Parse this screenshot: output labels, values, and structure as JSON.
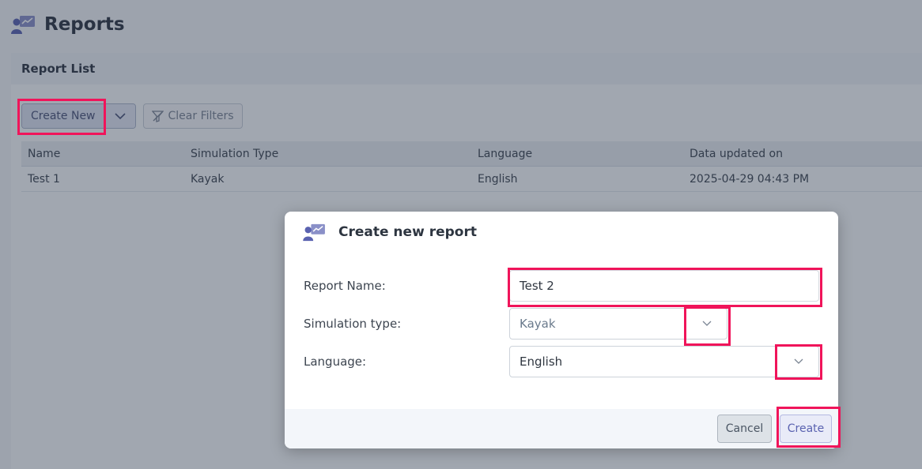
{
  "page": {
    "title": "Reports",
    "icon": "report-presentation-icon"
  },
  "panel": {
    "title": "Report List",
    "toolbar": {
      "create_new_label": "Create New",
      "clear_filters_label": "Clear Filters"
    },
    "table": {
      "columns": [
        "Name",
        "Simulation Type",
        "Language",
        "Data updated on"
      ],
      "rows": [
        [
          "Test 1",
          "Kayak",
          "English",
          "2025-04-29 04:43 PM"
        ]
      ]
    }
  },
  "modal": {
    "title": "Create new report",
    "icon": "report-presentation-icon",
    "fields": {
      "report_name": {
        "label": "Report Name:",
        "value": "Test 2"
      },
      "simulation_type": {
        "label": "Simulation type:",
        "value": "Kayak"
      },
      "language": {
        "label": "Language:",
        "value": "English"
      }
    },
    "buttons": {
      "cancel": "Cancel",
      "create": "Create"
    }
  },
  "colors": {
    "highlight": "#f0145a",
    "accent": "#5a62b0"
  }
}
